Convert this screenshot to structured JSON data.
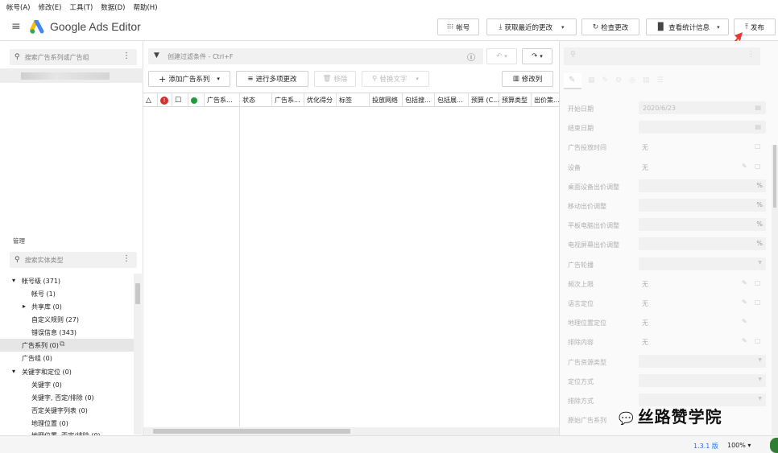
{
  "menu": [
    "帐号(A)",
    "修改(E)",
    "工具(T)",
    "数据(D)",
    "帮助(H)"
  ],
  "app": {
    "brand": "Google Ads Editor"
  },
  "toolbar": {
    "account": "帐号",
    "get_changes": "获取最近的更改",
    "check_changes": "检查更改",
    "view_stats": "查看统计信息",
    "publish": "发布"
  },
  "left": {
    "search_placeholder": "搜索广告系列或广告组",
    "manage_label": "管理",
    "type_search_placeholder": "搜索实体类型",
    "tree": [
      {
        "label": "帐号级 (371)",
        "expand": "▾"
      },
      {
        "label": "帐号 (1)"
      },
      {
        "label": "共享库 (0)",
        "expand": "▸"
      },
      {
        "label": "自定义规则 (27)"
      },
      {
        "label": "错误信息 (343)"
      },
      {
        "label": "广告系列 (0)"
      },
      {
        "label": "广告组 (0)"
      },
      {
        "label": "关键字和定位 (0)",
        "expand": "▾"
      },
      {
        "label": "关键字 (0)"
      },
      {
        "label": "关键字, 否定/排除 (0)"
      },
      {
        "label": "否定关键字列表 (0)"
      },
      {
        "label": "地理位置 (0)"
      },
      {
        "label": "地理位置, 否定/排除 (0)"
      }
    ]
  },
  "mid": {
    "filter_placeholder": "创建过滤条件 - Ctrl+F",
    "add_campaign": "添加广告系列",
    "multi_edit": "进行多项更改",
    "remove": "移除",
    "replace_text": "替换文字",
    "modify_columns": "修改列",
    "columns": [
      "广告系...",
      "状态",
      "广告系...",
      "优化得分",
      "标签",
      "投放网络",
      "包括搜...",
      "包括展...",
      "预算 (C...",
      "预算类型",
      "出价策..."
    ]
  },
  "props": {
    "fields": [
      {
        "label": "开始日期",
        "value": "2020/6/23",
        "kind": "date"
      },
      {
        "label": "结束日期",
        "value": "",
        "kind": "date"
      },
      {
        "label": "广告投放时间",
        "value": "无",
        "kind": "copy"
      },
      {
        "label": "设备",
        "value": "无",
        "kind": "editcopy"
      },
      {
        "label": "桌面设备出价调整",
        "value": "%",
        "kind": "pct"
      },
      {
        "label": "移动出价调整",
        "value": "%",
        "kind": "pct"
      },
      {
        "label": "平板电脑出价调整",
        "value": "%",
        "kind": "pct"
      },
      {
        "label": "电视屏幕出价调整",
        "value": "%",
        "kind": "pct"
      },
      {
        "label": "广告轮播",
        "value": "",
        "kind": "dropdown"
      },
      {
        "label": "频次上限",
        "value": "无",
        "kind": "editcopy"
      },
      {
        "label": "语言定位",
        "value": "无",
        "kind": "editcopy"
      },
      {
        "label": "地理位置定位",
        "value": "无",
        "kind": "edit"
      },
      {
        "label": "排除内容",
        "value": "无",
        "kind": "editcopy"
      },
      {
        "label": "广告资源类型",
        "value": "",
        "kind": "dropdown"
      },
      {
        "label": "定位方式",
        "value": "",
        "kind": "dropdown"
      },
      {
        "label": "排除方式",
        "value": "",
        "kind": "dropdown"
      },
      {
        "label": "原始广告系列",
        "value": "",
        "kind": "none"
      }
    ]
  },
  "status": {
    "version": "1.3.1 版",
    "zoom": "100%"
  },
  "watermark": "丝路赞学院",
  "colors": {
    "accent": "#1a73e8",
    "annotation_arrow": "#e53935",
    "error_red": "#d32f2f",
    "ok_green": "#1e9e3a"
  }
}
